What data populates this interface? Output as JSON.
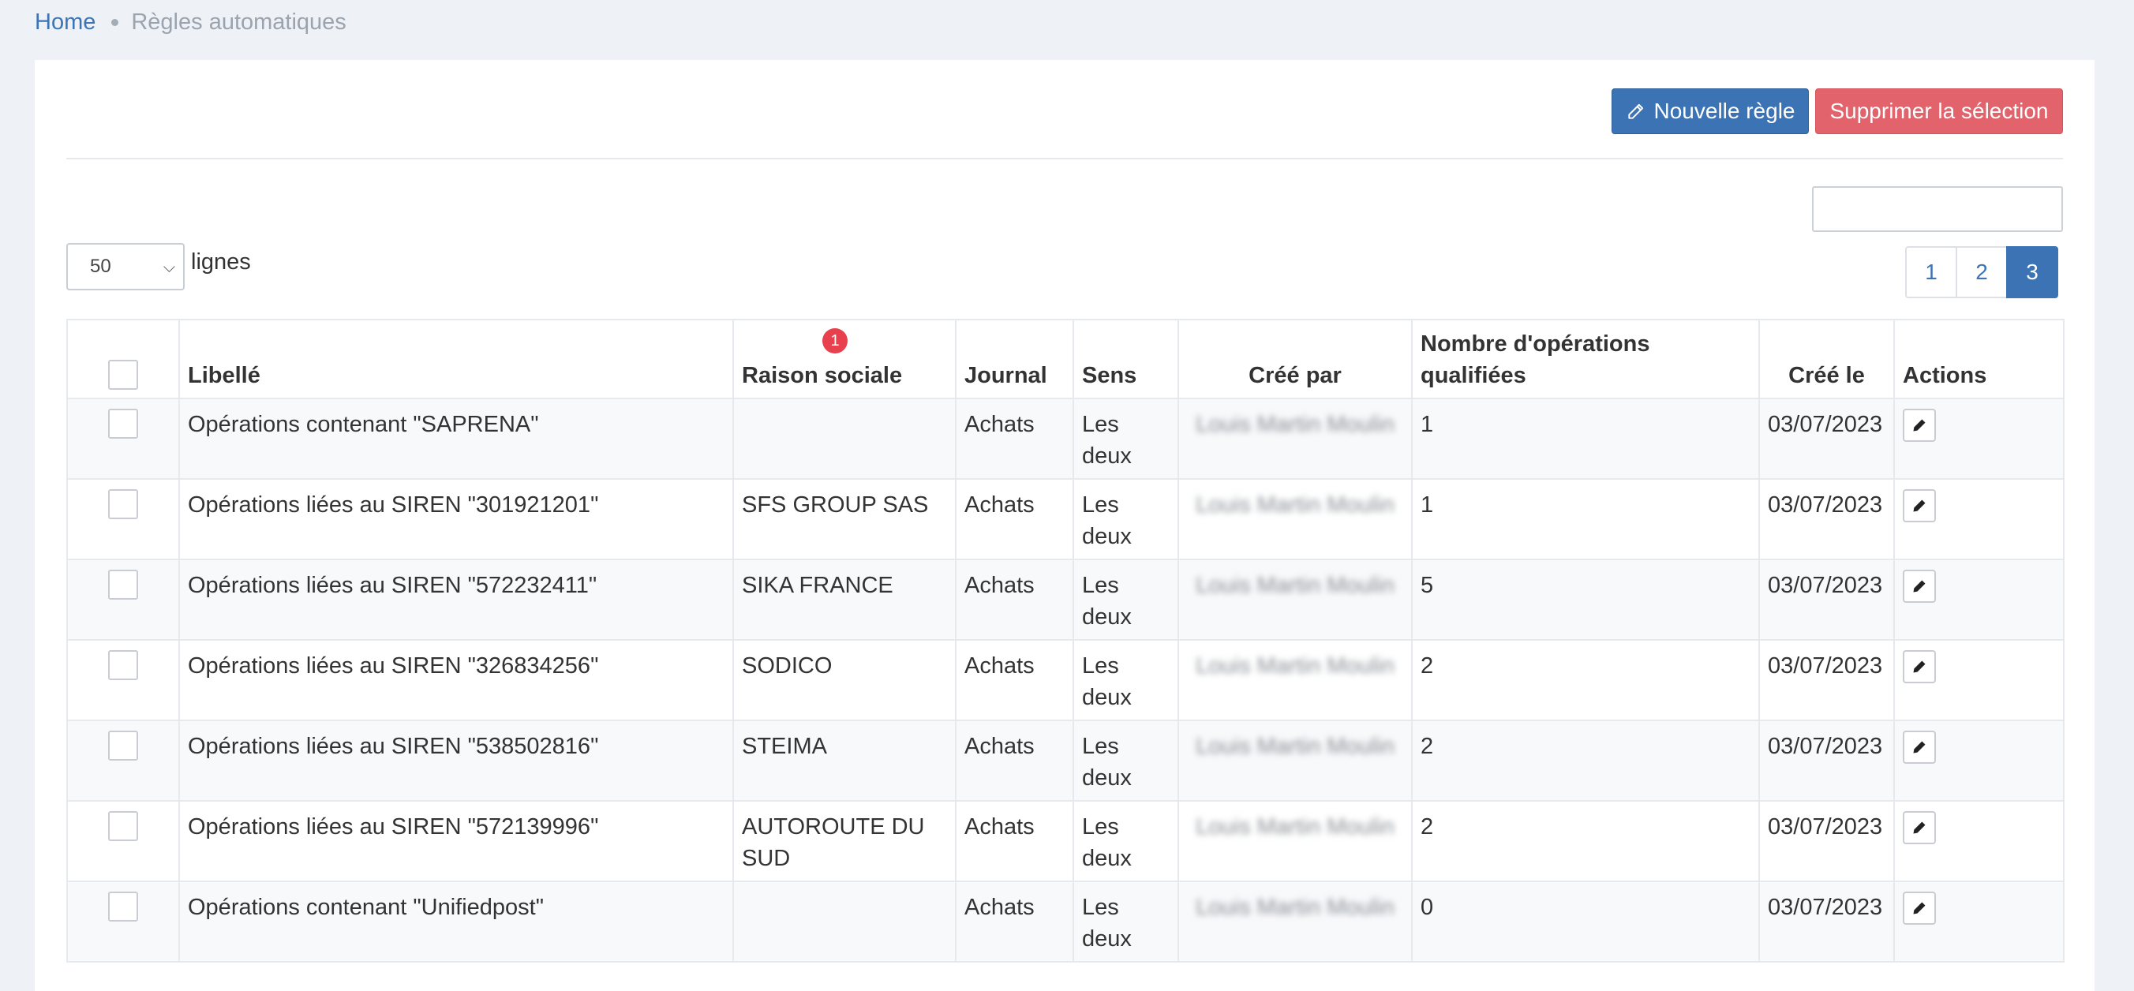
{
  "breadcrumb": {
    "home": "Home",
    "current": "Règles automatiques"
  },
  "toolbar": {
    "new_rule": "Nouvelle règle",
    "delete_selection": "Supprimer la sélection"
  },
  "search": {
    "value": ""
  },
  "page_size": {
    "selected": "50",
    "label": "lignes"
  },
  "pagination": {
    "pages": [
      "1",
      "2",
      "3"
    ],
    "active": "3"
  },
  "table": {
    "headers": {
      "libelle": "Libellé",
      "raison_sociale": "Raison sociale",
      "raison_badge": "1",
      "journal": "Journal",
      "sens": "Sens",
      "cree_par": "Créé par",
      "nombre": "Nombre d'opérations qualifiées",
      "cree_le": "Créé le",
      "actions": "Actions"
    },
    "rows": [
      {
        "libelle": "Opérations contenant \"SAPRENA\"",
        "raison": "",
        "journal": "Achats",
        "sens": "Les deux",
        "cree_par": "Louis Martin Moulin",
        "nombre": "1",
        "date": "03/07/2023"
      },
      {
        "libelle": "Opérations liées au SIREN \"301921201\"",
        "raison": "SFS GROUP SAS",
        "journal": "Achats",
        "sens": "Les deux",
        "cree_par": "Louis Martin Moulin",
        "nombre": "1",
        "date": "03/07/2023"
      },
      {
        "libelle": "Opérations liées au SIREN \"572232411\"",
        "raison": "SIKA FRANCE",
        "journal": "Achats",
        "sens": "Les deux",
        "cree_par": "Louis Martin Moulin",
        "nombre": "5",
        "date": "03/07/2023"
      },
      {
        "libelle": "Opérations liées au SIREN \"326834256\"",
        "raison": "SODICO",
        "journal": "Achats",
        "sens": "Les deux",
        "cree_par": "Louis Martin Moulin",
        "nombre": "2",
        "date": "03/07/2023"
      },
      {
        "libelle": "Opérations liées au SIREN \"538502816\"",
        "raison": "STEIMA",
        "journal": "Achats",
        "sens": "Les deux",
        "cree_par": "Louis Martin Moulin",
        "nombre": "2",
        "date": "03/07/2023"
      },
      {
        "libelle": "Opérations liées au SIREN \"572139996\"",
        "raison": "AUTOROUTE DU SUD",
        "journal": "Achats",
        "sens": "Les deux",
        "cree_par": "Louis Martin Moulin",
        "nombre": "2",
        "date": "03/07/2023"
      },
      {
        "libelle": "Opérations contenant \"Unifiedpost\"",
        "raison": "",
        "journal": "Achats",
        "sens": "Les deux",
        "cree_par": "Louis Martin Moulin",
        "nombre": "0",
        "date": "03/07/2023"
      }
    ]
  }
}
